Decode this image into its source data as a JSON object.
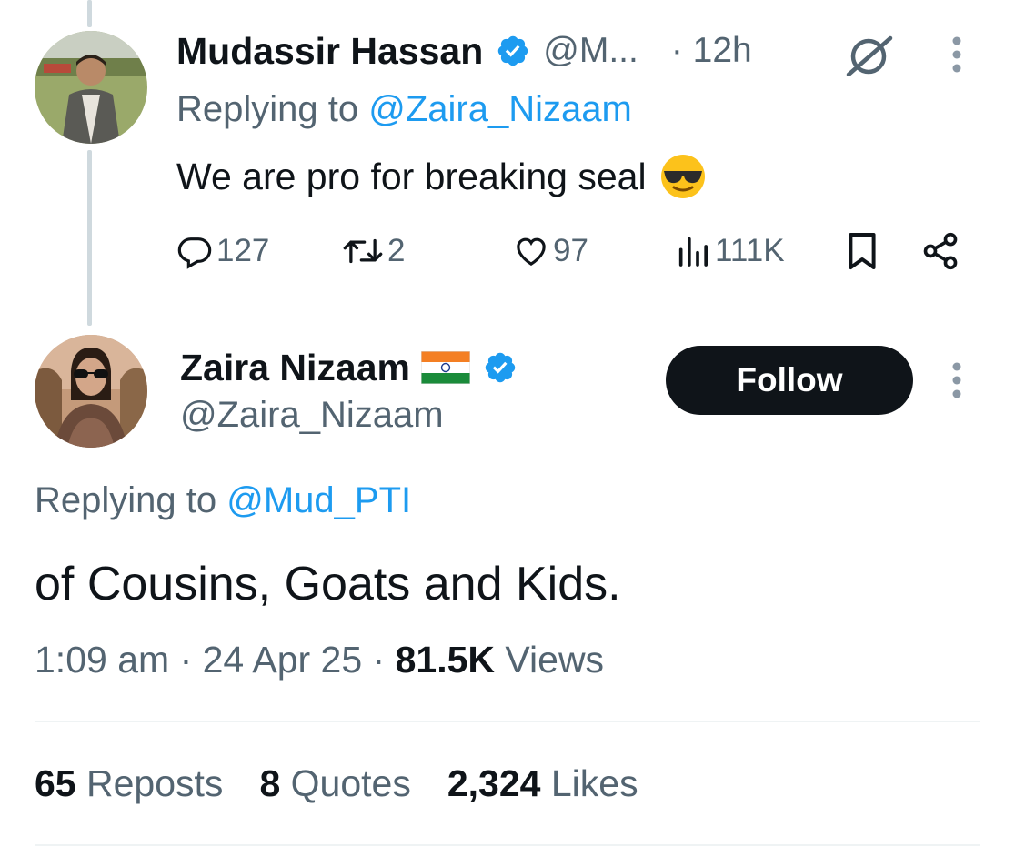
{
  "reply_tweet": {
    "author_name": "Mudassir Hassan",
    "handle_truncated": "@M...",
    "time": "· 12h",
    "replying_prefix": "Replying to ",
    "replying_to": "@Zaira_Nizaam",
    "text": "We are pro for breaking seal",
    "emoji": "smiling-face-with-sunglasses",
    "counts": {
      "replies": "127",
      "reposts": "2",
      "likes": "97",
      "views": "111K"
    }
  },
  "main_tweet": {
    "author_name": "Zaira Nizaam",
    "flag": "india-flag",
    "handle": "@Zaira_Nizaam",
    "follow_label": "Follow",
    "replying_prefix": "Replying to ",
    "replying_to": "@Mud_PTI",
    "text": "of Cousins, Goats and Kids.",
    "time": "1:09 am",
    "date": "24 Apr 25",
    "views_count": "81.5K",
    "views_label": "Views",
    "stats": {
      "reposts_count": "65",
      "reposts_label": "Reposts",
      "quotes_count": "8",
      "quotes_label": "Quotes",
      "likes_count": "2,324",
      "likes_label": "Likes"
    }
  },
  "colors": {
    "text_primary": "#0f1419",
    "text_secondary": "#536471",
    "link": "#1d9bf0",
    "verified": "#1d9bf0",
    "follow_bg": "#0f1419",
    "thread_line": "#cfd9de"
  }
}
